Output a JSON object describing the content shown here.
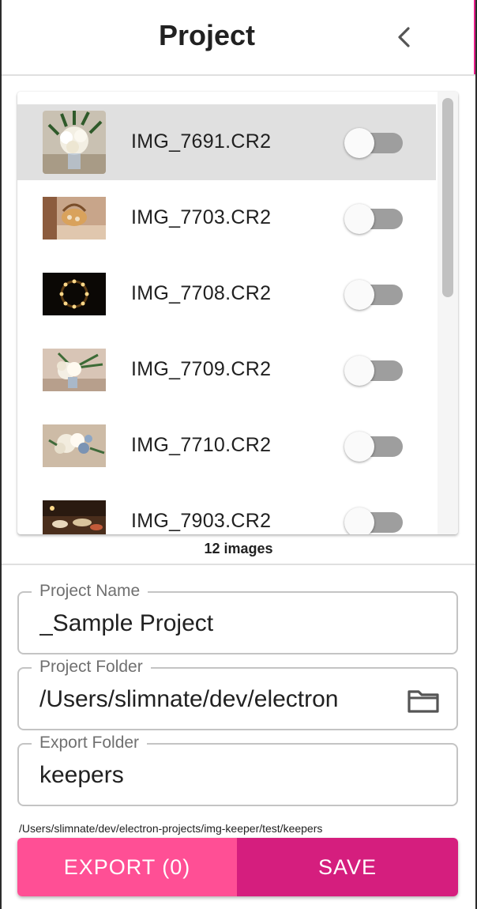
{
  "header": {
    "title": "Project",
    "back_icon": "chevron-left-icon"
  },
  "images": [
    {
      "name": "IMG_7691.CR2",
      "selected": true,
      "keep": false
    },
    {
      "name": "IMG_7703.CR2",
      "selected": false,
      "keep": false
    },
    {
      "name": "IMG_7708.CR2",
      "selected": false,
      "keep": false
    },
    {
      "name": "IMG_7709.CR2",
      "selected": false,
      "keep": false
    },
    {
      "name": "IMG_7710.CR2",
      "selected": false,
      "keep": false
    },
    {
      "name": "IMG_7903.CR2",
      "selected": false,
      "keep": false
    }
  ],
  "image_count": "12 images",
  "form": {
    "project_name": {
      "label": "Project Name",
      "value": "_Sample Project"
    },
    "project_folder": {
      "label": "Project Folder",
      "value": "/Users/slimnate/dev/electron",
      "icon": "folder-icon"
    },
    "export_folder": {
      "label": "Export Folder",
      "value": "keepers"
    },
    "resolved_path": "/Users/slimnate/dev/electron-projects/img-keeper/test/keepers"
  },
  "actions": {
    "export_label": "EXPORT (0)",
    "save_label": "SAVE"
  },
  "colors": {
    "accent": "#ff4f95",
    "accent_dark": "#d51e7e",
    "selected_row": "#e0e0e0",
    "toggle_track": "#9e9e9e"
  }
}
